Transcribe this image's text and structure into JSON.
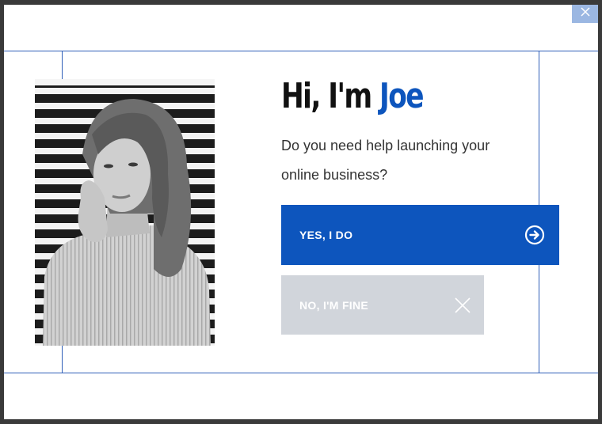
{
  "modal": {
    "headline_prefix": "Hi, I'm",
    "headline_name": "Joe",
    "subtext": "Do you need help launching your online business?",
    "yes_button_label": "YES, I DO",
    "no_button_label": "NO, I'M FINE",
    "close_icon": "close-icon",
    "yes_icon": "circle-arrow-right-icon",
    "no_icon": "x-icon",
    "photo_alt": "photo"
  },
  "colors": {
    "accent": "#0d55bd",
    "secondary_button": "#d1d5db",
    "close_button": "#9bb7e2",
    "overlay": "#3a3a3a"
  }
}
